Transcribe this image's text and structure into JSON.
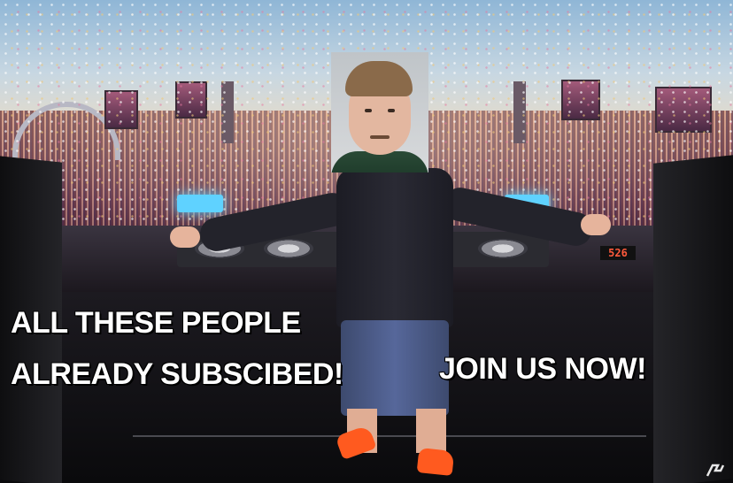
{
  "meme": {
    "caption_left_line1": "ALL THESE PEOPLE",
    "caption_left_line2": "ALREADY SUBSCIBED!",
    "caption_right": "JOIN US NOW!"
  },
  "stage": {
    "led_display": "526"
  },
  "colors": {
    "caption_text": "#ffffff",
    "shoes": "#ff5a1f",
    "led_text": "#ff5a3c"
  }
}
